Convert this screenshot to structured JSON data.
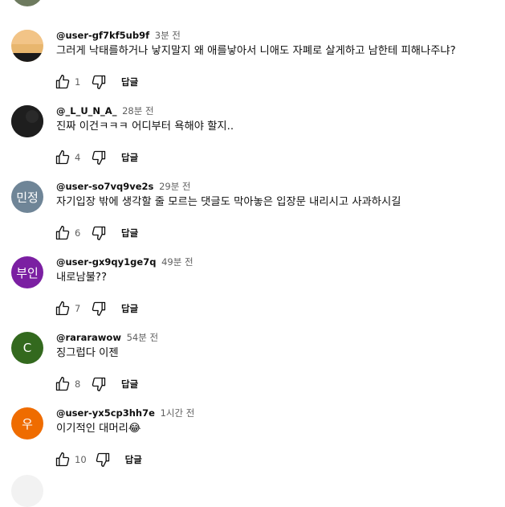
{
  "comments": [
    {
      "author": "@user-gf7kf5ub9f",
      "time": "3분 전",
      "text": "그러게 낙태를하거나 낳지말지 왜 애를낳아서 니애도 자폐로 살게하고 남한테 피해나주냐?",
      "likes": "1",
      "reply": "답글",
      "avatar_initials": "",
      "avatar_color": "#e8b66e",
      "avatar_icon": "sunset-photo-avatar"
    },
    {
      "author": "@_L_U_N_A_",
      "time": "28분 전",
      "text": "진짜 이건ㅋㅋㅋ 어디부터 욕해야 할지..",
      "likes": "4",
      "reply": "답글",
      "avatar_initials": "",
      "avatar_color": "#1c1c1c",
      "avatar_icon": "dark-photo-avatar"
    },
    {
      "author": "@user-so7vq9ve2s",
      "time": "29분 전",
      "text": "자기입장 밖에 생각할 줄 모르는 댓글도 막아놓은 입장문 내리시고 사과하시길",
      "likes": "6",
      "reply": "답글",
      "avatar_initials": "민정",
      "avatar_color": "#6f8597"
    },
    {
      "author": "@user-gx9qy1ge7q",
      "time": "49분 전",
      "text": "내로남불??",
      "likes": "7",
      "reply": "답글",
      "avatar_initials": "부인",
      "avatar_color": "#7b1fa2"
    },
    {
      "author": "@rararawow",
      "time": "54분 전",
      "text": "징그럽다 이젠",
      "likes": "8",
      "reply": "답글",
      "avatar_initials": "C",
      "avatar_color": "#33691e"
    },
    {
      "author": "@user-yx5cp3hh7e",
      "time": "1시간 전",
      "text": "이기적인 대머리",
      "text_emoji": "😂",
      "likes": "10",
      "reply": "답글",
      "avatar_initials": "우",
      "avatar_color": "#ef6c00"
    }
  ]
}
